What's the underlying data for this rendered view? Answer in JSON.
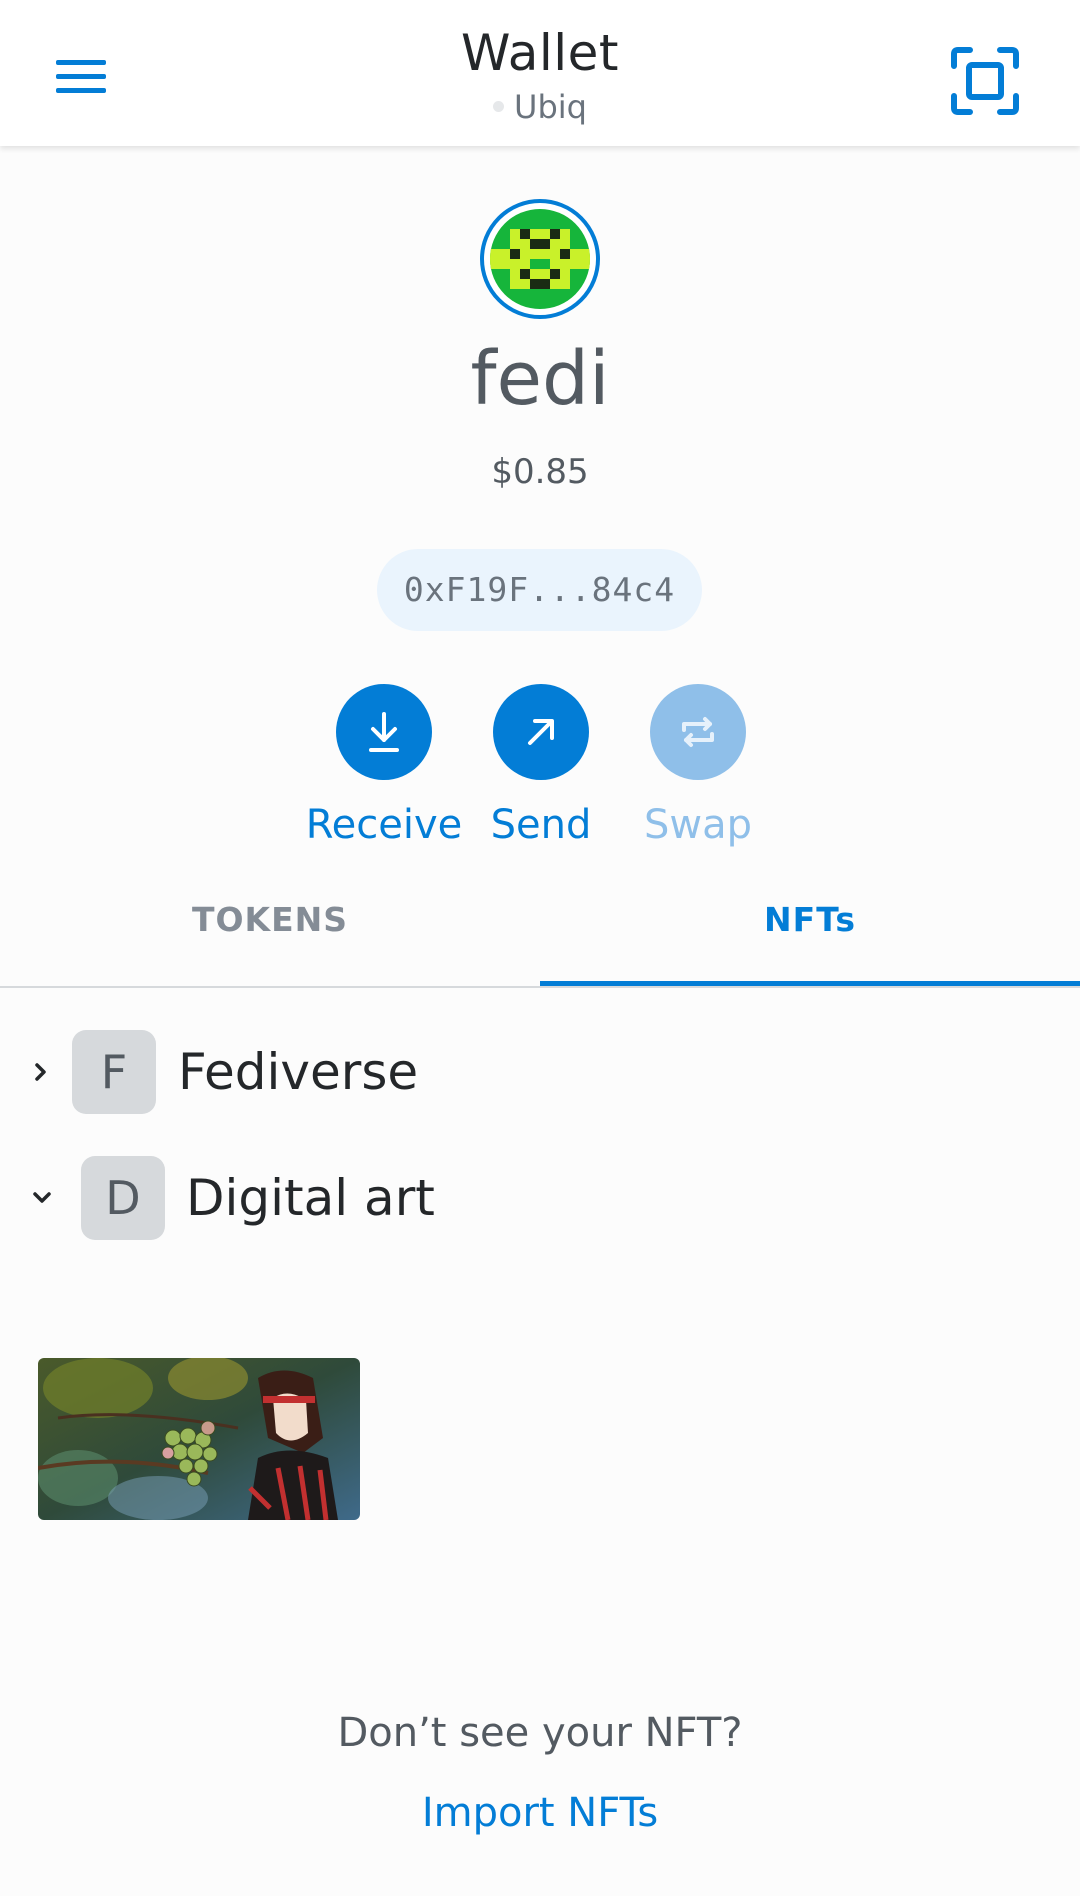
{
  "header": {
    "title": "Wallet",
    "network": "Ubiq",
    "menu_icon": "hamburger-menu-icon",
    "scan_icon": "qr-scan-icon"
  },
  "account": {
    "name": "fedi",
    "balance": "$0.85",
    "address": "0xF19F...84c4"
  },
  "actions": [
    {
      "label": "Receive",
      "icon": "download-arrow-icon",
      "enabled": true
    },
    {
      "label": "Send",
      "icon": "arrow-up-right-icon",
      "enabled": true
    },
    {
      "label": "Swap",
      "icon": "swap-arrows-icon",
      "enabled": false
    }
  ],
  "tabs": [
    {
      "label": "TOKENS",
      "active": false
    },
    {
      "label": "NFTs",
      "active": true
    }
  ],
  "collections": [
    {
      "badge": "F",
      "name": "Fediverse",
      "expanded": false
    },
    {
      "badge": "D",
      "name": "Digital art",
      "expanded": true
    }
  ],
  "footer": {
    "prompt": "Don’t see your NFT?",
    "import_label": "Import NFTs"
  },
  "colors": {
    "accent": "#037dd6",
    "accent_disabled": "#8fbfe9",
    "pill_bg": "#eaf4fd"
  }
}
